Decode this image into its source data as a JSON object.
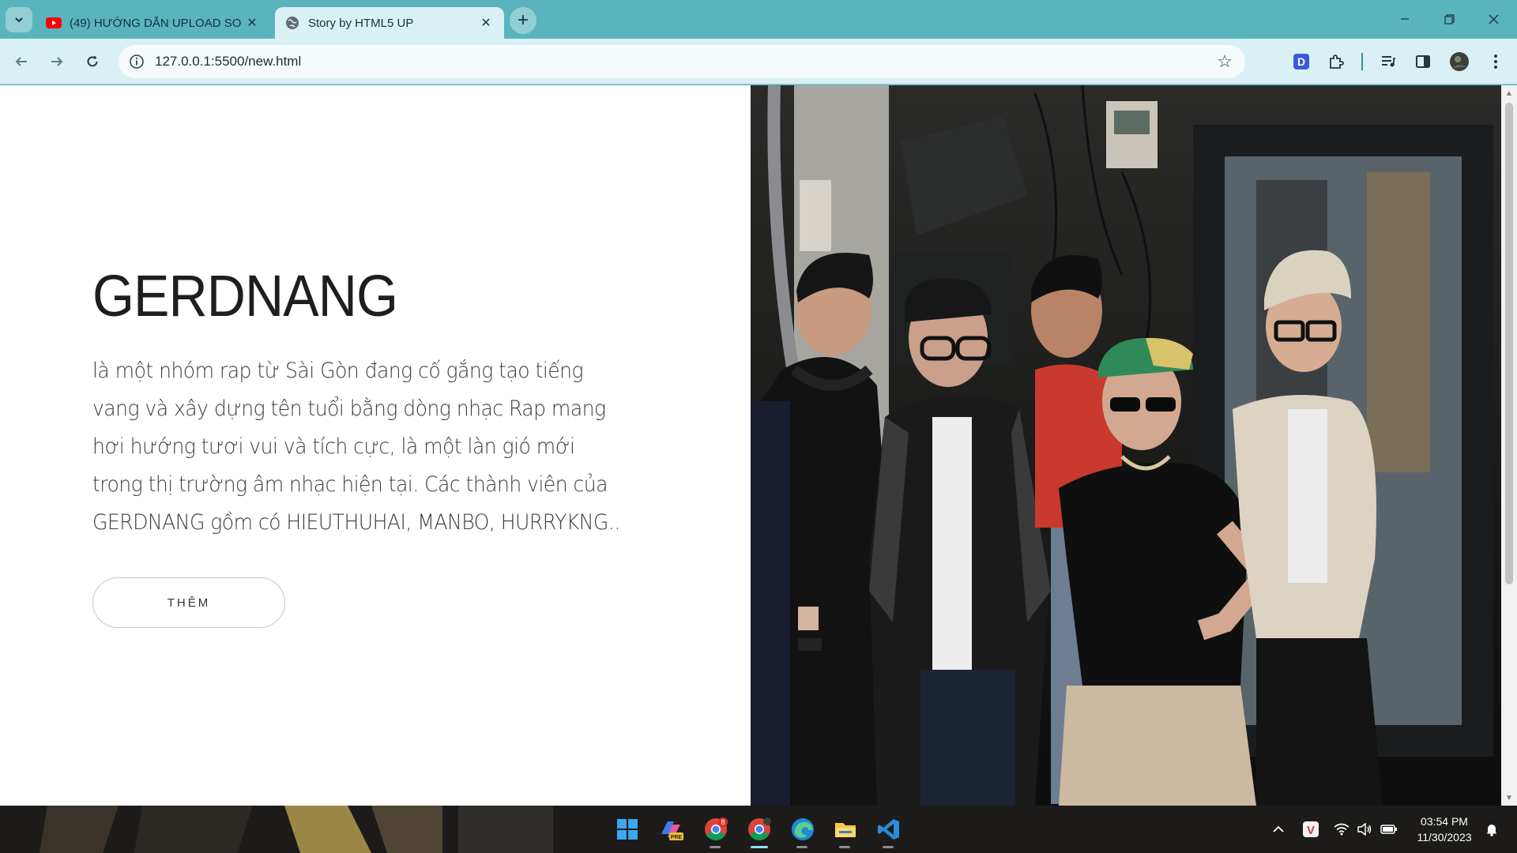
{
  "browser": {
    "tabs": [
      {
        "title": "(49) HƯỚNG DẪN UPLOAD SO",
        "icon": "youtube-icon",
        "active": false
      },
      {
        "title": "Story by HTML5 UP",
        "icon": "globe-icon",
        "active": true
      }
    ],
    "url": "127.0.0.1:5500/new.html",
    "extension_letter": "D"
  },
  "page": {
    "heading": "GERDNANG",
    "description": "là một nhóm rap từ Sài Gòn đang cố gắng tạo tiếng vang và xây dựng tên tuổi bằng dòng nhạc Rap mang hơi hướng tươi vui và tích cực, là một làn gió mới trong thị trường âm nhạc hiện tại. Các thành viên của GERDNANG gồm có HIEUTHUHAI, MANBO, HURRYKNG..",
    "button_label": "THÊM"
  },
  "taskbar": {
    "chrome_badge": "8",
    "copilot_badge": "PRE",
    "time": "03:54 PM",
    "date": "11/30/2023",
    "vivaldi_letter": "V"
  },
  "colors": {
    "frame": "#5ab4be",
    "toolbar": "#d9f1f4",
    "page_bg": "#ffffff",
    "text": "#3c3c3c"
  }
}
